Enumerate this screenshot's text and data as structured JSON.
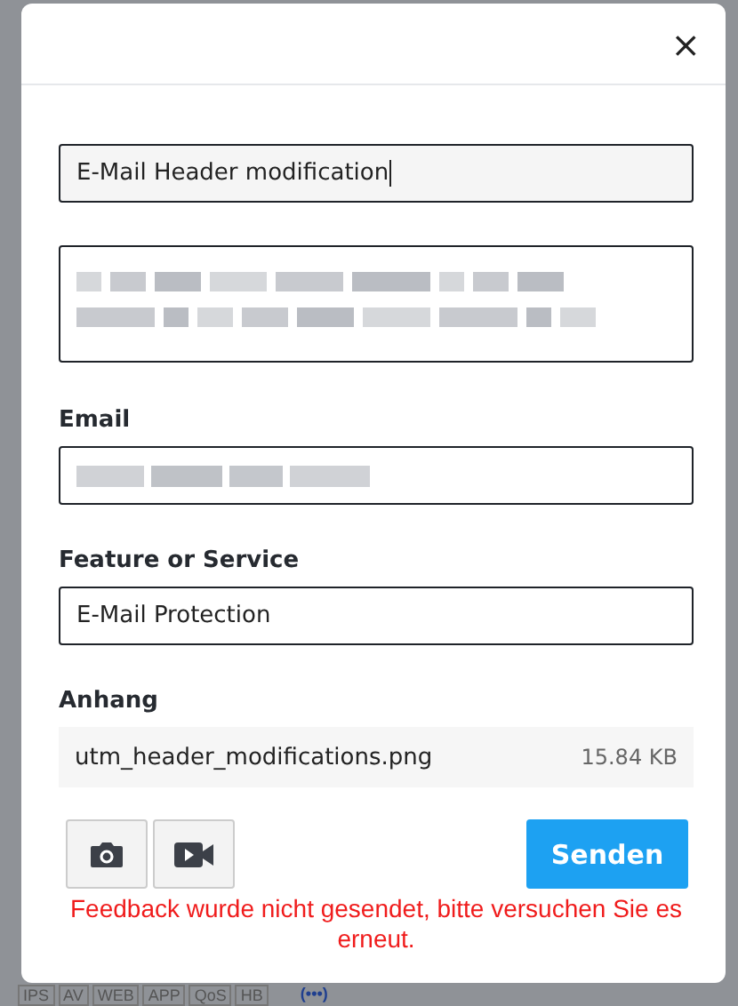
{
  "dialog": {
    "close": "×",
    "fields": [
      {
        "kind": "input",
        "value": "E-Mail Header modification",
        "focused": true
      },
      {
        "kind": "textarea",
        "blurred": true
      },
      {
        "kind": "input",
        "label": "Email",
        "blurred": true
      },
      {
        "kind": "input",
        "label": "Feature or Service",
        "value": "E-Mail Protection",
        "focused": false
      }
    ],
    "attachment": {
      "label": "Anhang",
      "name": "utm_header_modifications.png",
      "size": "15.84 KB"
    },
    "send_button": "Senden",
    "error": "Feedback wurde nicht gesendet, bitte versuchen Sie es erneut."
  },
  "background": {
    "tags": [
      "IPS",
      "AV",
      "WEB",
      "APP",
      "QoS",
      "HB"
    ],
    "more": "(•••)"
  }
}
